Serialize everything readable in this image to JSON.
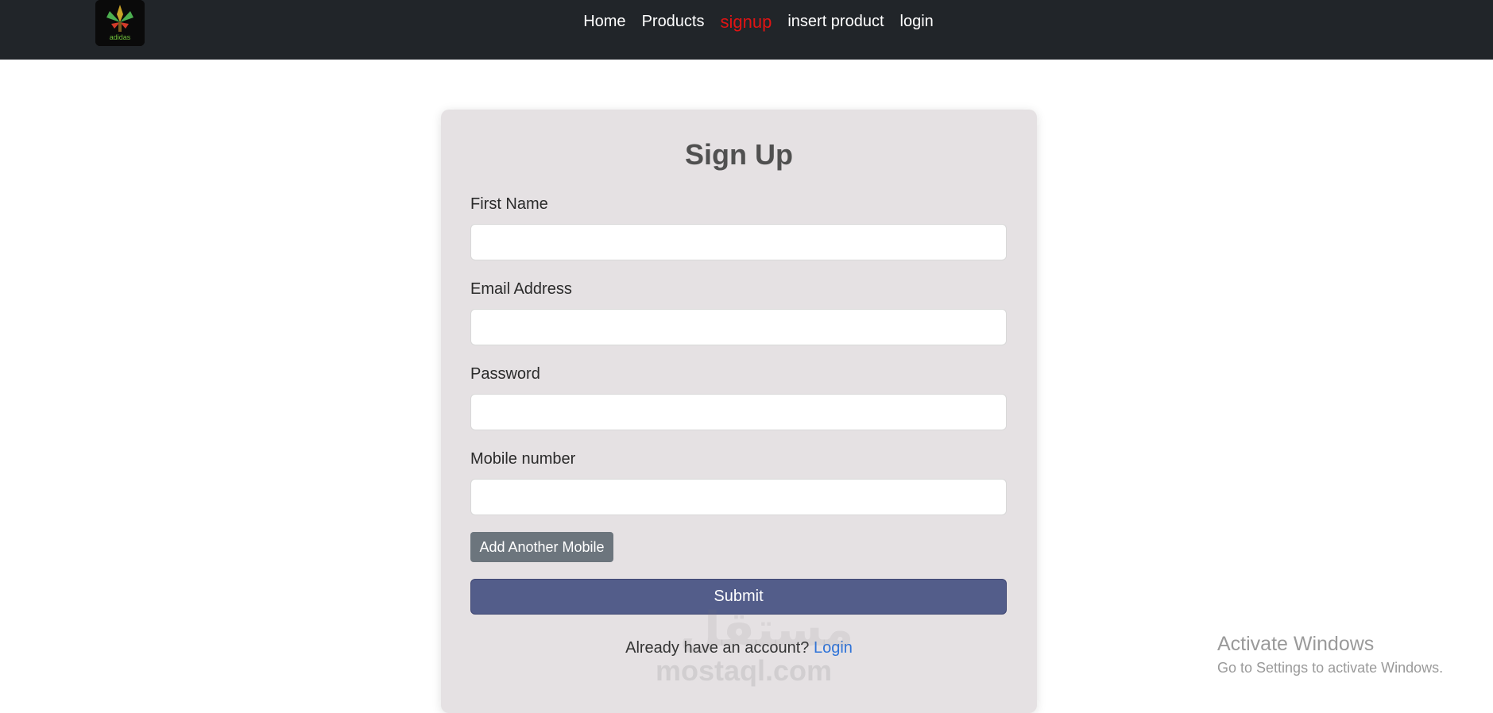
{
  "nav": {
    "items": [
      {
        "label": "Home"
      },
      {
        "label": "Products"
      },
      {
        "label": "signup"
      },
      {
        "label": "insert product"
      },
      {
        "label": "login"
      }
    ],
    "active_index": 2,
    "active_color": "#e01414",
    "logo_icon": "leaf-logo-icon"
  },
  "form": {
    "title": "Sign Up",
    "fields": [
      {
        "label": "First Name",
        "value": ""
      },
      {
        "label": "Email Address",
        "value": ""
      },
      {
        "label": "Password",
        "value": ""
      },
      {
        "label": "Mobile number",
        "value": ""
      }
    ],
    "add_mobile_label": "Add Another Mobile",
    "submit_label": "Submit",
    "login_prompt": "Already have an account?",
    "login_link": "Login"
  },
  "watermark": {
    "arabic": "مستقل",
    "domain": "mostaql.com"
  },
  "windows_notice": {
    "title": "Activate Windows",
    "subtitle": "Go to Settings to activate Windows."
  },
  "colors": {
    "navbar_bg": "#212529",
    "card_bg": "#e5e1e3",
    "submit_bg": "#535d8a",
    "secondary_btn_bg": "#6c757d",
    "link": "#2f73d8"
  }
}
